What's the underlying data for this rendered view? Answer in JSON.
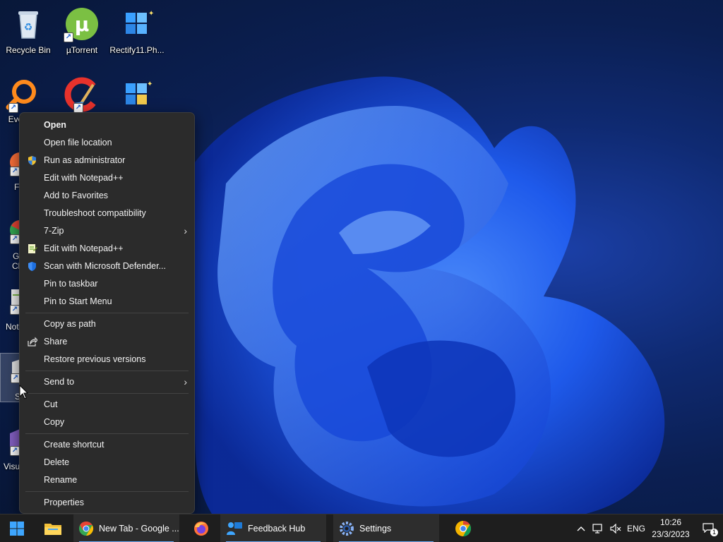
{
  "desktop": {
    "icons": [
      {
        "label": "Recycle Bin",
        "icon": "recycle-bin-icon"
      },
      {
        "label": "µTorrent",
        "icon": "utorrent-icon"
      },
      {
        "label": "Rectify11.Ph...",
        "icon": "rectify11-icon"
      },
      {
        "label": "Eve",
        "icon": "everything-search-icon"
      },
      {
        "label": "",
        "icon": "ccleaner-icon"
      },
      {
        "label": "",
        "icon": "windows-tool-icon"
      },
      {
        "label": "F",
        "icon": "firefox-icon"
      },
      {
        "label": "G",
        "label2": "Cl",
        "icon": "chrome-icon"
      },
      {
        "label": "Not",
        "icon": "notepad-plus-plus-icon"
      },
      {
        "label": "S",
        "icon": "selected-shortcut-icon"
      },
      {
        "label": "Visu",
        "icon": "visual-studio-icon"
      }
    ]
  },
  "context_menu": {
    "groups": [
      [
        {
          "label": "Open",
          "bold": true
        },
        {
          "label": "Open file location"
        },
        {
          "label": "Run as administrator",
          "icon": "shield-icon"
        },
        {
          "label": "Edit with Notepad++"
        },
        {
          "label": "Add to Favorites"
        },
        {
          "label": "Troubleshoot compatibility"
        },
        {
          "label": "7-Zip",
          "submenu": true
        },
        {
          "label": "Edit with Notepad++",
          "icon": "notepad-plus-plus-icon"
        },
        {
          "label": "Scan with Microsoft Defender...",
          "icon": "defender-icon"
        },
        {
          "label": "Pin to taskbar"
        },
        {
          "label": "Pin to Start Menu"
        }
      ],
      [
        {
          "label": "Copy as path"
        },
        {
          "label": "Share",
          "icon": "share-icon"
        },
        {
          "label": "Restore previous versions"
        }
      ],
      [
        {
          "label": "Send to",
          "submenu": true
        }
      ],
      [
        {
          "label": "Cut"
        },
        {
          "label": "Copy"
        }
      ],
      [
        {
          "label": "Create shortcut"
        },
        {
          "label": "Delete"
        },
        {
          "label": "Rename"
        }
      ],
      [
        {
          "label": "Properties"
        }
      ]
    ]
  },
  "taskbar": {
    "items": [
      {
        "label": "",
        "icon": "windows-start-icon"
      },
      {
        "label": "",
        "icon": "file-explorer-icon"
      },
      {
        "label": "New Tab - Google ...",
        "icon": "chrome-icon"
      },
      {
        "label": "",
        "icon": "firefox-icon"
      },
      {
        "label": "Feedback Hub",
        "icon": "feedback-hub-icon"
      },
      {
        "label": "Settings",
        "icon": "settings-gear-icon"
      },
      {
        "label": "",
        "icon": "chromium-icon"
      }
    ],
    "tray": {
      "language": "ENG",
      "time": "10:26",
      "date": "23/3/2023",
      "notification_count": "1"
    }
  },
  "colors": {
    "menu_bg": "#2b2b2b",
    "taskbar_bg": "#1e1e1e",
    "accent": "#6aa9f5"
  }
}
